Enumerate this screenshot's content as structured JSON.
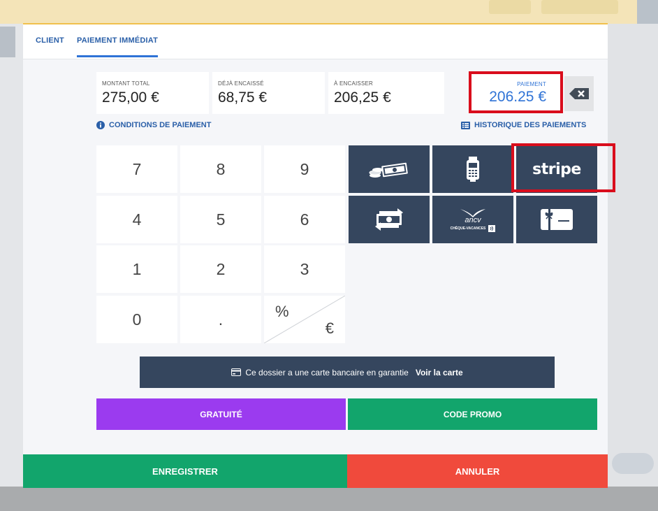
{
  "tabs": [
    {
      "label": "CLIENT"
    },
    {
      "label": "PAIEMENT IMMÉDIAT"
    }
  ],
  "summary": {
    "total_label": "MONTANT TOTAL",
    "total_value": "275,00 €",
    "cashed_label": "DÉJÀ ENCAISSÉ",
    "cashed_value": "68,75 €",
    "due_label": "À ENCAISSER",
    "due_value": "206,25 €",
    "payment_label": "PAIEMENT",
    "payment_value": "206.25 €"
  },
  "links": {
    "conditions": "CONDITIONS DE PAIEMENT",
    "history": "HISTORIQUE DES PAIEMENTS"
  },
  "keypad": {
    "keys": [
      "7",
      "8",
      "9",
      "4",
      "5",
      "6",
      "1",
      "2",
      "3",
      "0",
      "."
    ],
    "percent": "%",
    "euro": "€"
  },
  "payment_methods": {
    "stripe": "stripe",
    "ancv": "ancv",
    "ancv_sub": "CHÈQUE-VACANCES"
  },
  "card_banner": {
    "text": "Ce dossier a une carte bancaire en garantie",
    "link": "Voir la carte"
  },
  "buttons": {
    "gratuite": "GRATUITÉ",
    "promo": "CODE PROMO",
    "save": "ENREGISTRER",
    "cancel": "ANNULER"
  },
  "colors": {
    "primary_blue": "#2f73d6",
    "dark_tile": "#35465e",
    "highlight_red": "#d90d1c",
    "purple": "#9b3bef",
    "green": "#12a56c",
    "red": "#f04a3c"
  }
}
